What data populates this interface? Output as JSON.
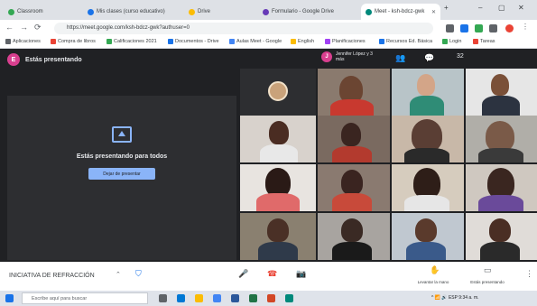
{
  "browser": {
    "tabs": [
      {
        "label": "Classroom",
        "color": "#34a853"
      },
      {
        "label": "Mis clases (curso educativo)",
        "color": "#1a73e8"
      },
      {
        "label": "Drive",
        "color": "#fbbc04"
      },
      {
        "label": "Formulario - Google Drive",
        "color": "#673ab7"
      },
      {
        "label": "Meet - ksh-bdcz-gwk",
        "color": "#00897b"
      }
    ],
    "url": "https://meet.google.com/ksh-bdcz-gwk?authuser=0",
    "window_controls": {
      "minimize": "–",
      "maximize": "▢",
      "close": "✕"
    },
    "nav": {
      "back": "←",
      "forward": "→",
      "reload": "⟳"
    },
    "bookmarks": [
      {
        "label": "Aplicaciones",
        "color": "#5f6368"
      },
      {
        "label": "Compra de libros",
        "color": "#ea4335"
      },
      {
        "label": "Calificaciones 2021",
        "color": "#34a853"
      },
      {
        "label": "Documentos - Drive",
        "color": "#1a73e8"
      },
      {
        "label": "Aulas Meet - Google",
        "color": "#4285f4"
      },
      {
        "label": "English",
        "color": "#fbbc04"
      },
      {
        "label": "Planificaciones",
        "color": "#a142f4"
      },
      {
        "label": "Recursos Ed. Básica",
        "color": "#1a73e8"
      },
      {
        "label": "Login",
        "color": "#34a853"
      },
      {
        "label": "Tareas",
        "color": "#ea4335"
      }
    ]
  },
  "meet": {
    "presenter_initial": "E",
    "presentation_title": "Estás presentando",
    "presentation_message": "Estás presentando para todos",
    "stop_button": "Dejar de presentar",
    "pinned_initial": "J",
    "pinned_name": "Jennifer López y 3 más",
    "participant_count": "32",
    "clock": "9:34",
    "meeting_title": "INICIATIVA DE REFRACCIÓN",
    "icons": {
      "people": "👥",
      "chat": "💬",
      "mic": "🎤",
      "hangup": "☎",
      "camera": "📷",
      "more": "⋮",
      "hand": "✋",
      "present": "▭",
      "shield": "⛉",
      "caret": "⌃"
    },
    "controls": {
      "raise_hand_label": "Levantar la mano",
      "present_label": "Estás presentando"
    },
    "tiles": [
      {
        "id": "t1",
        "kind": "avatar"
      },
      {
        "id": "t2",
        "kind": "video"
      },
      {
        "id": "t3",
        "kind": "video"
      },
      {
        "id": "t4",
        "kind": "video"
      },
      {
        "id": "t5",
        "kind": "video"
      },
      {
        "id": "t6",
        "kind": "video"
      },
      {
        "id": "t7",
        "kind": "video"
      },
      {
        "id": "t8",
        "kind": "video"
      },
      {
        "id": "t9",
        "kind": "video"
      },
      {
        "id": "t10",
        "kind": "video"
      },
      {
        "id": "t11",
        "kind": "video"
      },
      {
        "id": "t12",
        "kind": "video"
      },
      {
        "id": "t13",
        "kind": "video"
      },
      {
        "id": "t14",
        "kind": "video"
      },
      {
        "id": "t15",
        "kind": "video"
      },
      {
        "id": "t16",
        "kind": "video"
      },
      {
        "id": "t17",
        "kind": "video"
      },
      {
        "id": "t18",
        "kind": "video"
      },
      {
        "id": "t19",
        "kind": "video"
      },
      {
        "id": "t20",
        "kind": "video"
      }
    ]
  },
  "taskbar": {
    "search_placeholder": "Escribe aquí para buscar",
    "tray": "^ 📶 🔊 ESP 9:34 a. m."
  }
}
